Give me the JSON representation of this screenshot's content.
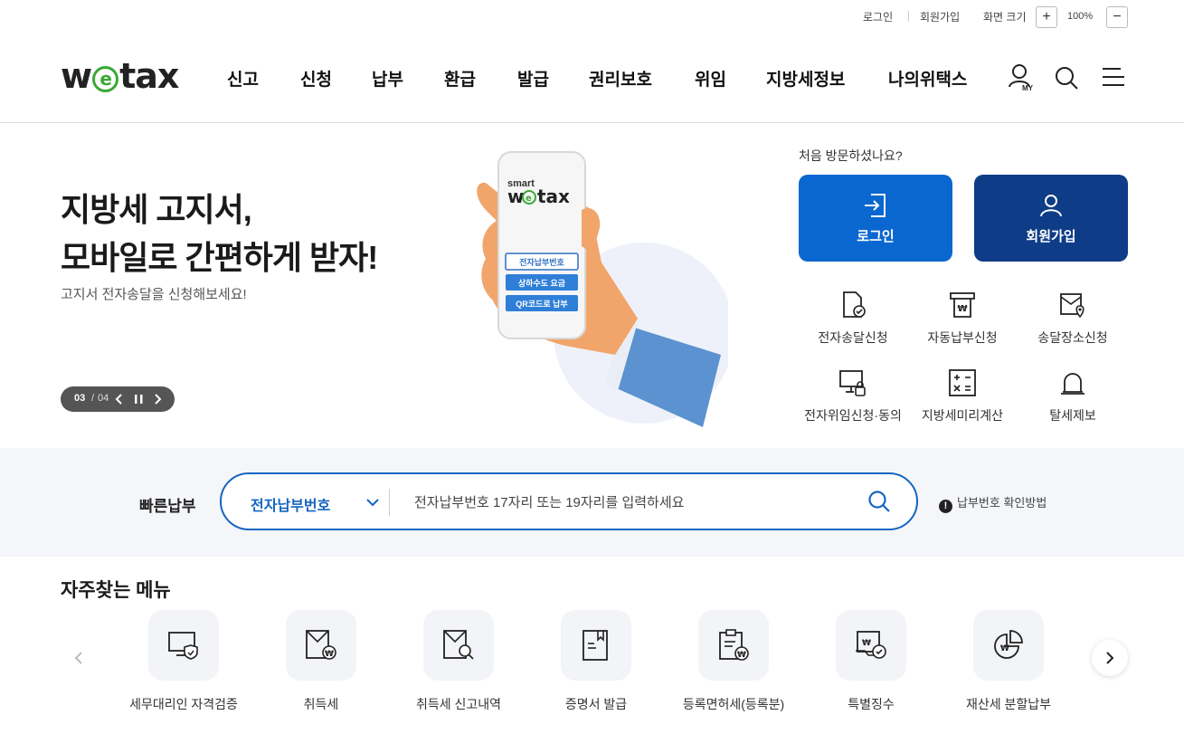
{
  "util": {
    "login": "로그인",
    "signup": "회원가입",
    "zoom_label": "화면 크기",
    "zoom_in": "+",
    "zoom_value": "100%",
    "zoom_out": "−"
  },
  "header": {
    "logo": {
      "w": "w",
      "e": "e",
      "tax": "tax"
    },
    "nav": [
      "신고",
      "신청",
      "납부",
      "환급",
      "발급",
      "권리보호",
      "위임",
      "지방세정보",
      "나의위택스"
    ],
    "icons": [
      "my-user-icon",
      "search-icon",
      "menu-icon"
    ],
    "my_label": "MY"
  },
  "hero": {
    "title_line1": "지방세 고지서,",
    "title_line2": "모바일로 간편하게 받자!",
    "subtitle": "고지서 전자송달을 신청해보세요!",
    "slide_current": "03",
    "slide_sep": "/",
    "slide_total": "04",
    "phone": {
      "brand_small": "smart",
      "brand_w": "w",
      "brand_e": "e",
      "brand_tax": "tax",
      "btn1": "전자납부번호",
      "btn2": "상하수도 요금",
      "btn3": "QR코드로 납부"
    }
  },
  "member": {
    "question": "처음 방문하셨나요?",
    "login_button": "로그인",
    "signup_button": "회원가입",
    "login_color": "#0a67d0",
    "signup_color": "#0e3c87",
    "services": [
      "전자송달신청",
      "자동납부신청",
      "송달장소신청",
      "전자위임신청·동의",
      "지방세미리계산",
      "탈세제보"
    ]
  },
  "quickpay": {
    "label": "빠른납부",
    "select_value": "전자납부번호",
    "placeholder": "전자납부번호 17자리 또는 19자리를 입력하세요",
    "help_mark": "!",
    "help": "납부번호 확인방법",
    "accent": "#1565c0"
  },
  "frequent": {
    "title": "자주찾는 메뉴",
    "items": [
      "세무대리인 자격검증",
      "취득세",
      "취득세 신고내역",
      "증명서 발급",
      "등록면허세(등록분)",
      "특별징수",
      "재산세 분할납부"
    ]
  }
}
